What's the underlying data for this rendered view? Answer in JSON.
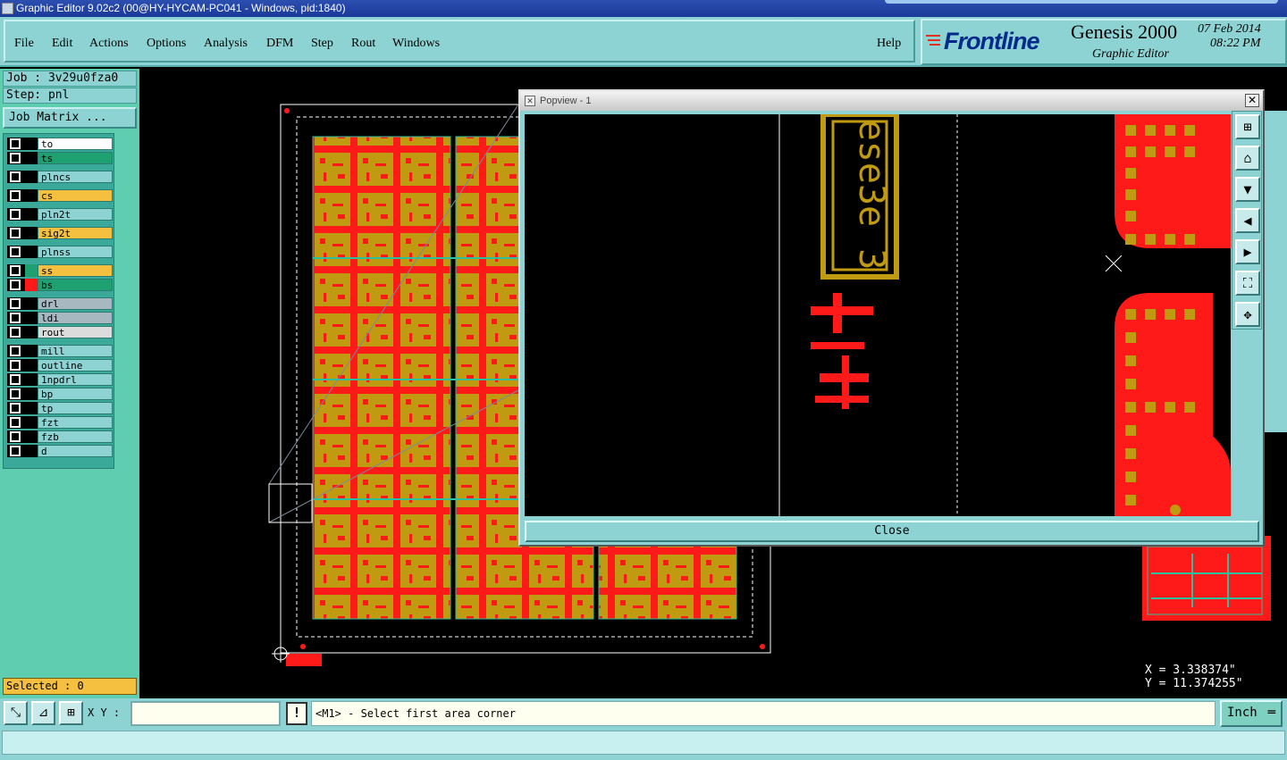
{
  "window": {
    "title": "Graphic Editor 9.02c2 (00@HY-HYCAM-PC041 - Windows, pid:1840)"
  },
  "menu": [
    "File",
    "Edit",
    "Actions",
    "Options",
    "Analysis",
    "DFM",
    "Step",
    "Rout",
    "Windows"
  ],
  "help_label": "Help",
  "brand": {
    "frontline": "Frontline",
    "product": "Genesis 2000",
    "subtitle": "Graphic Editor",
    "date": "07 Feb 2014",
    "time": "08:22 PM"
  },
  "job": {
    "job_line": "Job : 3v29u0fza0",
    "step_line": "Step: pnl",
    "matrix_button": "Job Matrix ..."
  },
  "layers": [
    {
      "name": "to",
      "color": "#ffffff"
    },
    {
      "name": "ts",
      "color": "#1fa070"
    },
    {
      "name": "plncs",
      "color": "#8ed3d3"
    },
    {
      "name": "cs",
      "color": "#f5c040"
    },
    {
      "name": "pln2t",
      "color": "#8ed3d3"
    },
    {
      "name": "sig2t",
      "color": "#f5c040"
    },
    {
      "name": "plnss",
      "color": "#8ed3d3"
    },
    {
      "name": "ss",
      "color": "#f5c040"
    },
    {
      "name": "bs",
      "color": "#1fa070"
    },
    {
      "name": "drl",
      "color": "#a8b8c0"
    },
    {
      "name": "ldi",
      "color": "#a8b8c0"
    },
    {
      "name": "rout",
      "color": "#dcdcdc"
    },
    {
      "name": "mill",
      "color": "#8ed3d3"
    },
    {
      "name": "outline",
      "color": "#8ed3d3"
    },
    {
      "name": "1npdrl",
      "color": "#8ed3d3"
    },
    {
      "name": "bp",
      "color": "#8ed3d3"
    },
    {
      "name": "tp",
      "color": "#8ed3d3"
    },
    {
      "name": "fzt",
      "color": "#8ed3d3"
    },
    {
      "name": "fzb",
      "color": "#8ed3d3"
    },
    {
      "name": "d",
      "color": "#8ed3d3"
    }
  ],
  "selected_label": "Selected : 0",
  "popview": {
    "title": "Popview - 1",
    "close_label": "Close",
    "silk_text": "ese3e 3"
  },
  "coords": {
    "x": "X = 3.338374\"",
    "y": "Y = 11.374255\""
  },
  "bottom": {
    "xy_label": "X Y :",
    "xy_value": "",
    "warn": "!",
    "prompt": "<M1> - Select first area corner",
    "unit": "Inch"
  },
  "colors": {
    "panel": "#8ed3d3",
    "layer_panel": "#5ecdb0",
    "copper": "#ff1a1a",
    "mask": "#c09a10"
  }
}
